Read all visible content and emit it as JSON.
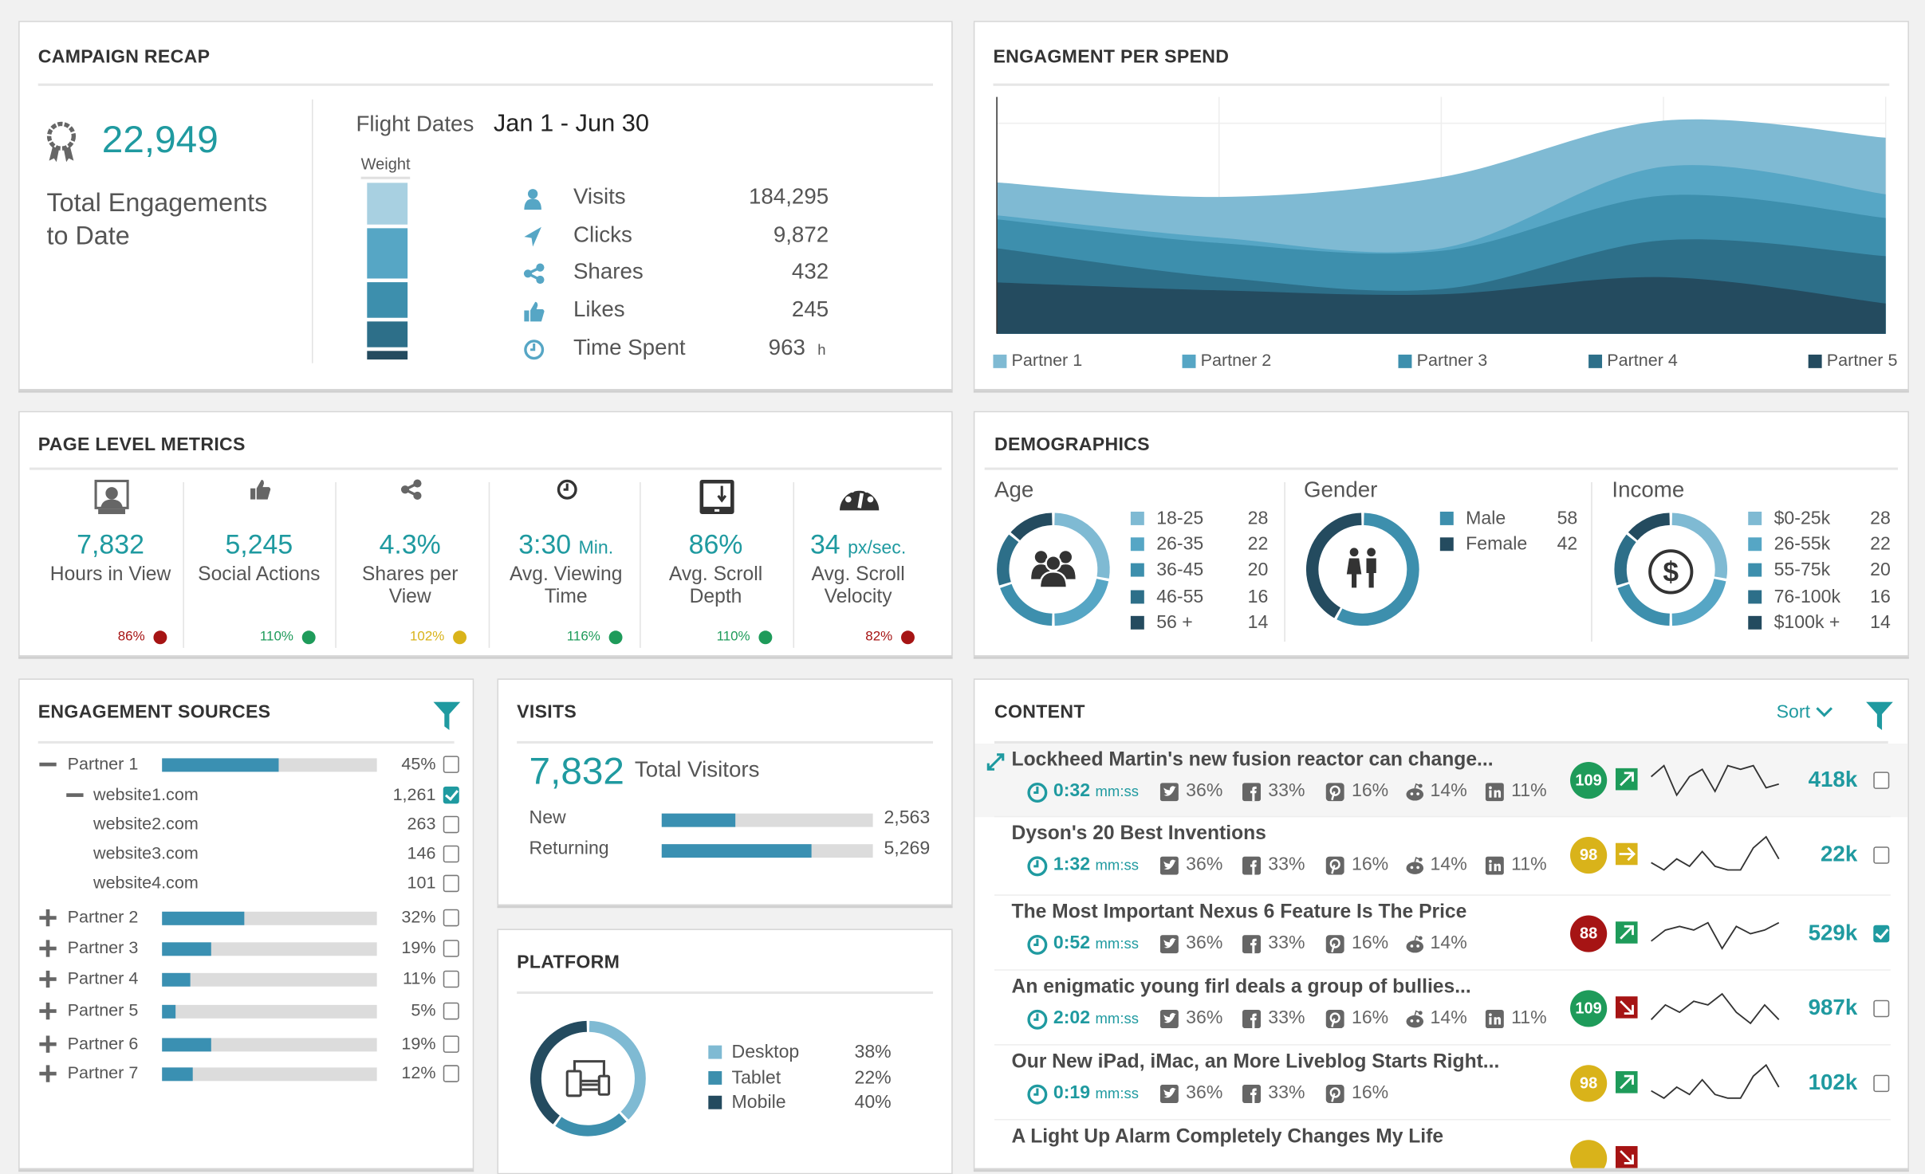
{
  "colors": {
    "teal": "#1f9aa0",
    "p1": "#7fbad3",
    "p2": "#56a6c5",
    "p3": "#3d8fad",
    "p4": "#2d6f89",
    "p5": "#244b5f",
    "green": "#1e9b5a",
    "yellow": "#d9b31a",
    "red": "#a61414",
    "bar": "#3a90b2"
  },
  "campaign_recap": {
    "title": "CAMPAIGN RECAP",
    "total": "22,949",
    "total_label": "Total Engagements to Date",
    "flight_label": "Flight Dates",
    "flight_dates": "Jan 1 - Jun 30",
    "weight_label": "Weight",
    "weights_percent": [
      25,
      30,
      22,
      16,
      7
    ],
    "metrics": [
      {
        "icon": "user-icon",
        "label": "Visits",
        "value": "184,295",
        "unit": ""
      },
      {
        "icon": "paper-plane-icon",
        "label": "Clicks",
        "value": "9,872",
        "unit": ""
      },
      {
        "icon": "share-icon",
        "label": "Shares",
        "value": "432",
        "unit": ""
      },
      {
        "icon": "thumbs-up-icon",
        "label": "Likes",
        "value": "245",
        "unit": ""
      },
      {
        "icon": "clock-icon",
        "label": "Time Spent",
        "value": "963",
        "unit": "h"
      }
    ]
  },
  "engagement_per_spend": {
    "title": "ENGAGMENT PER SPEND"
  },
  "chart_data": {
    "type": "area",
    "stacked": true,
    "x": [
      0,
      1,
      2,
      3,
      4
    ],
    "ylim": [
      0,
      90
    ],
    "grid": true,
    "legend": "bottom",
    "series": [
      {
        "name": "Partner 1",
        "values": [
          12.5,
          15.5,
          27,
          17.5,
          21.5
        ]
      },
      {
        "name": "Partner 2",
        "values": [
          1.5,
          2,
          1,
          11,
          9
        ]
      },
      {
        "name": "Partner 3",
        "values": [
          11,
          13,
          14.5,
          17,
          14.5
        ]
      },
      {
        "name": "Partner 4",
        "values": [
          13,
          5,
          2,
          14,
          18
        ]
      },
      {
        "name": "Partner 5",
        "values": [
          19.5,
          16.5,
          15,
          21.5,
          11.5
        ]
      }
    ]
  },
  "page_metrics": {
    "title": "PAGE LEVEL METRICS",
    "items": [
      {
        "icon": "presenter-screen-icon",
        "value": "7,832",
        "unit": "",
        "label": "Hours in View",
        "status": "86%",
        "status_color": "red"
      },
      {
        "icon": "thumbs-up-icon",
        "value": "5,245",
        "unit": "",
        "label": "Social Actions",
        "status": "110%",
        "status_color": "green"
      },
      {
        "icon": "share-icon",
        "value": "4.3%",
        "unit": "",
        "label": "Shares per View",
        "status": "102%",
        "status_color": "yellow"
      },
      {
        "icon": "clock-icon",
        "value": "3:30",
        "unit": "Min.",
        "label": "Avg. Viewing Time",
        "status": "116%",
        "status_color": "green"
      },
      {
        "icon": "tablet-scroll-icon",
        "value": "86%",
        "unit": "",
        "label": "Avg. Scroll Depth",
        "status": "110%",
        "status_color": "green"
      },
      {
        "icon": "speedometer-icon",
        "value": "34",
        "unit": "px/sec.",
        "label": "Avg. Scroll Velocity",
        "status": "82%",
        "status_color": "red"
      }
    ]
  },
  "demographics": {
    "title": "DEMOGRAPHICS",
    "groups": [
      {
        "title": "Age",
        "icon": "group-icon",
        "items": [
          {
            "label": "18-25",
            "value": 28
          },
          {
            "label": "26-35",
            "value": 22
          },
          {
            "label": "36-45",
            "value": 20
          },
          {
            "label": "46-55",
            "value": 16
          },
          {
            "label": "56 +",
            "value": 14
          }
        ]
      },
      {
        "title": "Gender",
        "icon": "male-female-icon",
        "items": [
          {
            "label": "Male",
            "value": 58
          },
          {
            "label": "Female",
            "value": 42
          }
        ]
      },
      {
        "title": "Income",
        "icon": "dollar-icon",
        "items": [
          {
            "label": "$0-25k",
            "value": 28
          },
          {
            "label": "26-55k",
            "value": 22
          },
          {
            "label": "55-75k",
            "value": 20
          },
          {
            "label": "76-100k",
            "value": 16
          },
          {
            "label": "$100k +",
            "value": 14
          }
        ]
      }
    ]
  },
  "engagement_sources": {
    "title": "ENGAGEMENT SOURCES",
    "rows": [
      {
        "type": "partner",
        "label": "Partner 1",
        "expanded": true,
        "percent": 45,
        "value": "45%",
        "checked": false
      },
      {
        "type": "site",
        "label": "website1.com",
        "expanded": true,
        "value": "1,261",
        "checked": true
      },
      {
        "type": "site",
        "label": "website2.com",
        "value": "263",
        "checked": false
      },
      {
        "type": "site",
        "label": "website3.com",
        "value": "146",
        "checked": false
      },
      {
        "type": "site",
        "label": "website4.com",
        "value": "101",
        "checked": false
      },
      {
        "type": "partner",
        "label": "Partner 2",
        "expanded": false,
        "percent": 32,
        "value": "32%",
        "checked": false
      },
      {
        "type": "partner",
        "label": "Partner 3",
        "expanded": false,
        "percent": 19,
        "value": "19%",
        "checked": false
      },
      {
        "type": "partner",
        "label": "Partner 4",
        "expanded": false,
        "percent": 11,
        "value": "11%",
        "checked": false
      },
      {
        "type": "partner",
        "label": "Partner 5",
        "expanded": false,
        "percent": 5,
        "value": "5%",
        "checked": false
      },
      {
        "type": "partner",
        "label": "Partner 6",
        "expanded": false,
        "percent": 19,
        "value": "19%",
        "checked": false
      },
      {
        "type": "partner",
        "label": "Partner 7",
        "expanded": false,
        "percent": 12,
        "value": "12%",
        "checked": false
      }
    ]
  },
  "visits": {
    "title": "VISITS",
    "total": "7,832",
    "total_label": "Total Visitors",
    "rows": [
      {
        "label": "New",
        "value": "2,563",
        "percent": 35
      },
      {
        "label": "Returning",
        "value": "5,269",
        "percent": 71
      }
    ]
  },
  "platform": {
    "title": "PLATFORM",
    "icon": "devices-icon",
    "items": [
      {
        "label": "Desktop",
        "value": "38%",
        "percent": 38
      },
      {
        "label": "Tablet",
        "value": "22%",
        "percent": 22
      },
      {
        "label": "Mobile",
        "value": "40%",
        "percent": 40
      }
    ]
  },
  "content": {
    "title": "CONTENT",
    "sort_label": "Sort",
    "time_unit": "mm:ss",
    "rows": [
      {
        "title": "Lockheed Martin's new fusion reactor can change...",
        "time": "0:32",
        "social": [
          {
            "icon": "twitter-icon",
            "value": "36%"
          },
          {
            "icon": "facebook-icon",
            "value": "33%"
          },
          {
            "icon": "pinterest-icon",
            "value": "16%"
          },
          {
            "icon": "reddit-icon",
            "value": "14%"
          },
          {
            "icon": "linkedin-icon",
            "value": "11%"
          }
        ],
        "score": "109",
        "score_color": "green",
        "trend": "up",
        "trend_color": "green",
        "spark": [
          6,
          9,
          1,
          6,
          8,
          2,
          9,
          8,
          9,
          3,
          4
        ],
        "value": "418k",
        "checked": false,
        "highlighted": true
      },
      {
        "title": "Dyson's 20 Best Inventions",
        "time": "1:32",
        "social": [
          {
            "icon": "twitter-icon",
            "value": "36%"
          },
          {
            "icon": "facebook-icon",
            "value": "33%"
          },
          {
            "icon": "pinterest-icon",
            "value": "16%"
          },
          {
            "icon": "reddit-icon",
            "value": "14%"
          },
          {
            "icon": "linkedin-icon",
            "value": "11%"
          }
        ],
        "score": "98",
        "score_color": "yellow",
        "trend": "right",
        "trend_color": "yellow",
        "spark": [
          3,
          1,
          4,
          2,
          6,
          2,
          1,
          1,
          7,
          10,
          4
        ],
        "value": "22k",
        "checked": false
      },
      {
        "title": "The Most Important Nexus 6 Feature Is The Price",
        "time": "0:52",
        "social": [
          {
            "icon": "twitter-icon",
            "value": "36%"
          },
          {
            "icon": "facebook-icon",
            "value": "33%"
          },
          {
            "icon": "pinterest-icon",
            "value": "16%"
          },
          {
            "icon": "reddit-icon",
            "value": "14%"
          }
        ],
        "score": "88",
        "score_color": "red",
        "trend": "up",
        "trend_color": "green",
        "spark": [
          3,
          6,
          7,
          6,
          8,
          1,
          7,
          5,
          6,
          8
        ],
        "value": "529k",
        "checked": true
      },
      {
        "title": "An enigmatic young firl deals a group of bullies...",
        "time": "2:02",
        "social": [
          {
            "icon": "twitter-icon",
            "value": "36%"
          },
          {
            "icon": "facebook-icon",
            "value": "33%"
          },
          {
            "icon": "pinterest-icon",
            "value": "16%"
          },
          {
            "icon": "reddit-icon",
            "value": "14%"
          },
          {
            "icon": "linkedin-icon",
            "value": "11%"
          }
        ],
        "score": "109",
        "score_color": "green",
        "trend": "down",
        "trend_color": "red",
        "spark": [
          2,
          6,
          4,
          7,
          6,
          9,
          4,
          1,
          6,
          2
        ],
        "value": "987k",
        "checked": false
      },
      {
        "title": "Our New iPad, iMac, an More Liveblog Starts Right...",
        "time": "0:19",
        "social": [
          {
            "icon": "twitter-icon",
            "value": "36%"
          },
          {
            "icon": "facebook-icon",
            "value": "33%"
          },
          {
            "icon": "pinterest-icon",
            "value": "16%"
          }
        ],
        "score": "98",
        "score_color": "yellow",
        "trend": "up",
        "trend_color": "green",
        "spark": [
          3,
          1,
          4,
          2,
          6,
          2,
          1,
          1,
          7,
          10,
          4
        ],
        "value": "102k",
        "checked": false
      },
      {
        "title": "A Light Up Alarm Completely Changes My Life",
        "score_color": "yellow",
        "trend": "down",
        "trend_color": "red"
      }
    ]
  }
}
